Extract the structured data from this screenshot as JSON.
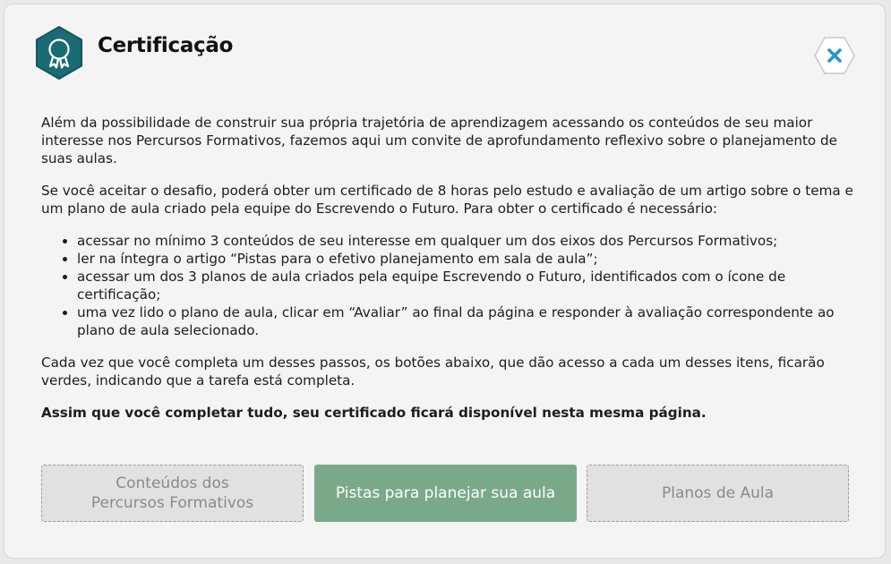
{
  "header": {
    "title": "Certificação",
    "icon": "certificate-badge-icon",
    "close_icon": "close-icon",
    "accent_color": "#1a6b74",
    "close_color": "#2a94c4"
  },
  "intro": {
    "paragraph1": "Além da possibilidade de construir sua própria trajetória de aprendizagem acessando os conteúdos de seu maior interesse nos Percursos Formativos, fazemos aqui um convite de aprofundamento reflexivo sobre o planejamento de suas aulas.",
    "paragraph2": "Se você aceitar o desafio, poderá obter um certificado de 8 horas pelo estudo e avaliação de um artigo sobre o tema e um plano de aula criado pela equipe do Escrevendo o Futuro. Para obter o certificado é necessário:",
    "steps": [
      "acessar no mínimo 3 conteúdos de seu interesse em qualquer um dos eixos dos Percursos Formativos;",
      "ler na íntegra o artigo “Pistas para o efetivo planejamento em sala de aula”;",
      "acessar um dos 3 planos de aula criados pela equipe Escrevendo o Futuro, identificados com o ícone de certificação;",
      "uma vez lido o plano de aula, clicar em “Avaliar” ao final da página e responder à avaliação correspondente ao plano de aula selecionado."
    ],
    "paragraph3": "Cada vez que você completa um desses passos, os botões abaixo, que dão acesso a cada um desses itens, ficarão verdes, indicando que a tarefa está completa.",
    "closing": "Assim que você completar tudo, seu certificado ficará disponível nesta mesma página."
  },
  "buttons": [
    {
      "label": "Conteúdos dos Percursos Formativos",
      "completed": false
    },
    {
      "label": "Pistas para planejar sua aula",
      "completed": true
    },
    {
      "label": "Planos de Aula",
      "completed": false
    }
  ],
  "colors": {
    "completed": "#7aa98a",
    "pending": "#e1e1e1"
  }
}
